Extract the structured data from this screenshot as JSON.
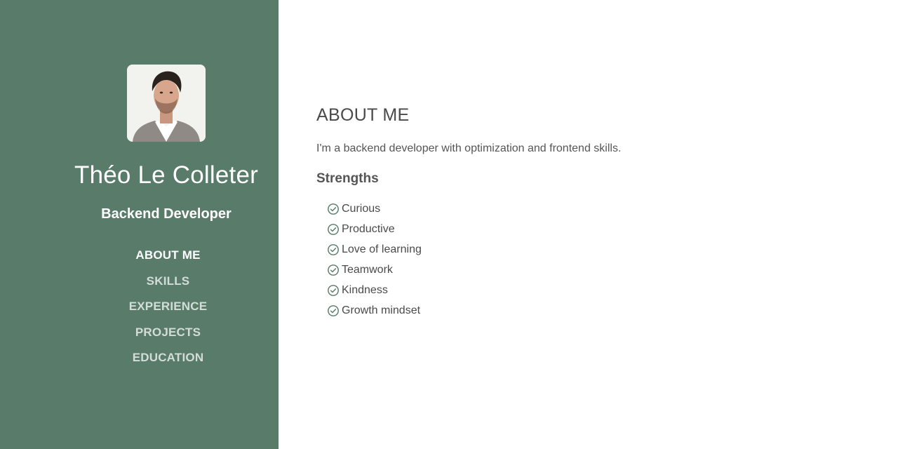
{
  "profile": {
    "name": "Théo Le Colleter",
    "role": "Backend Developer"
  },
  "nav": {
    "items": [
      {
        "label": "ABOUT ME",
        "active": true
      },
      {
        "label": "SKILLS",
        "active": false
      },
      {
        "label": "EXPERIENCE",
        "active": false
      },
      {
        "label": "PROJECTS",
        "active": false
      },
      {
        "label": "EDUCATION",
        "active": false
      }
    ]
  },
  "about": {
    "title": "ABOUT ME",
    "intro": "I'm a backend developer with optimization and frontend skills.",
    "strengths_heading": "Strengths",
    "strengths": [
      "Curious",
      "Productive",
      "Love of learning",
      "Teamwork",
      "Kindness",
      "Growth mindset"
    ]
  },
  "colors": {
    "sidebar_bg": "#597b6a",
    "check_icon": "#597b6a",
    "text": "#4a4a4a"
  },
  "icons": {
    "strength_item": "check-circle-icon",
    "avatar": "profile-photo"
  }
}
